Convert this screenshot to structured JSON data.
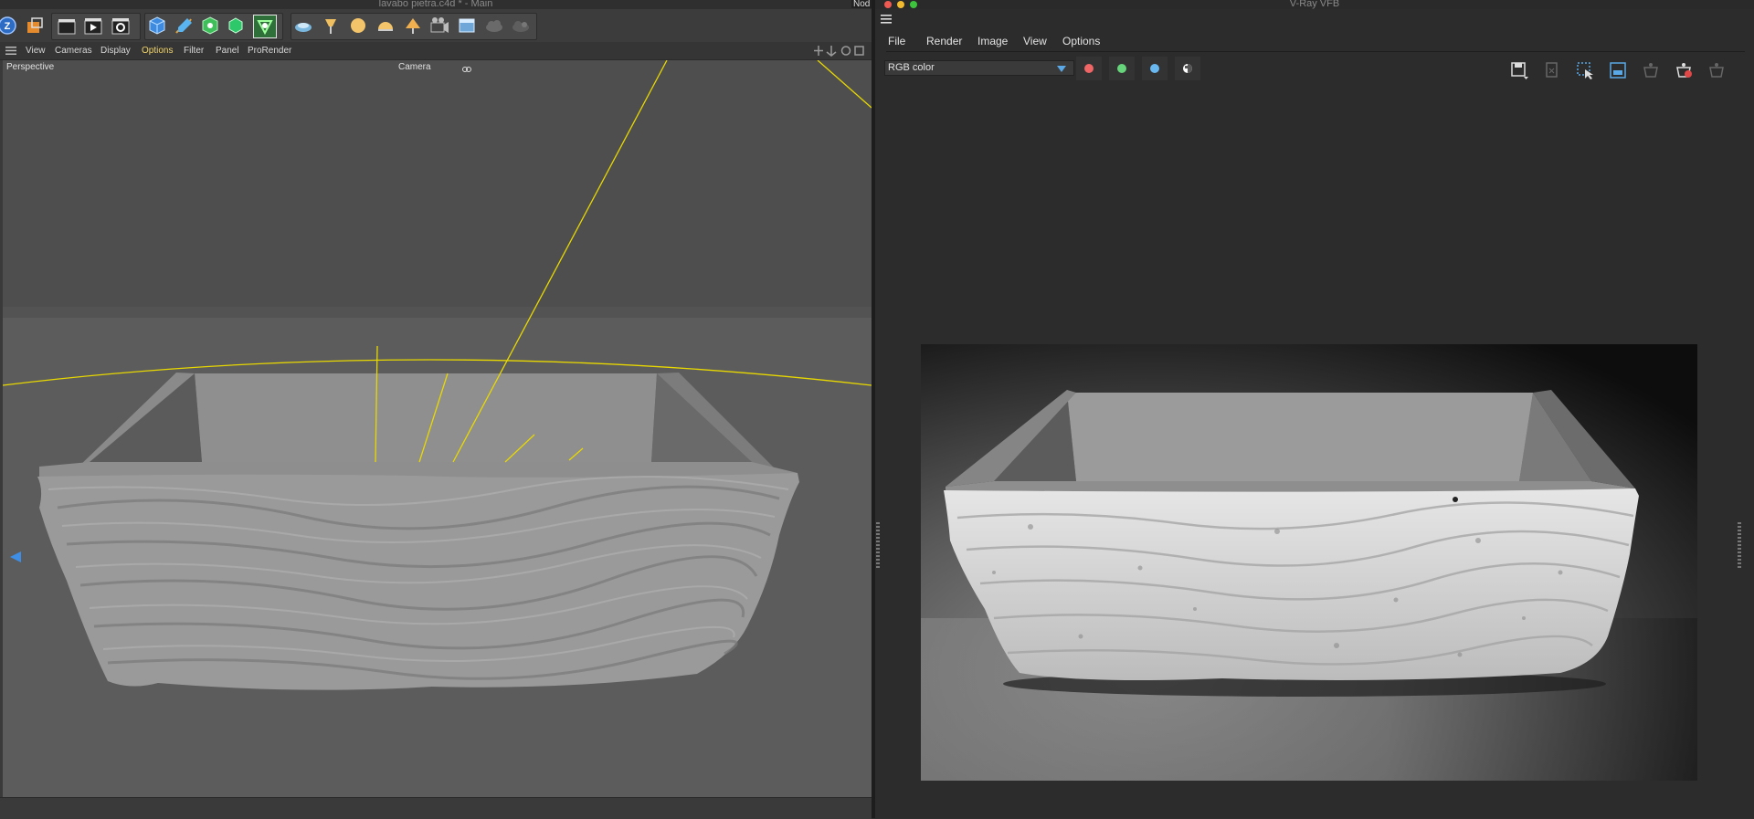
{
  "c4d": {
    "window_title": "lavabo pietra.c4d * - Main",
    "menu": [
      "View",
      "Cameras",
      "Display",
      "Options",
      "Filter",
      "Panel",
      "ProRender"
    ],
    "active_menu": "Options",
    "viewport_label": "Perspective",
    "camera_label": "Camera",
    "accent_color": "#f0d36a"
  },
  "node_tab": "Nod",
  "vfb": {
    "window_title": "V-Ray VFB",
    "menu": [
      "File",
      "Render",
      "Image",
      "View",
      "Options"
    ],
    "channel_select": "RGB color",
    "channel_dots": [
      "#f06666",
      "#66d47a",
      "#6ab8f0"
    ]
  }
}
